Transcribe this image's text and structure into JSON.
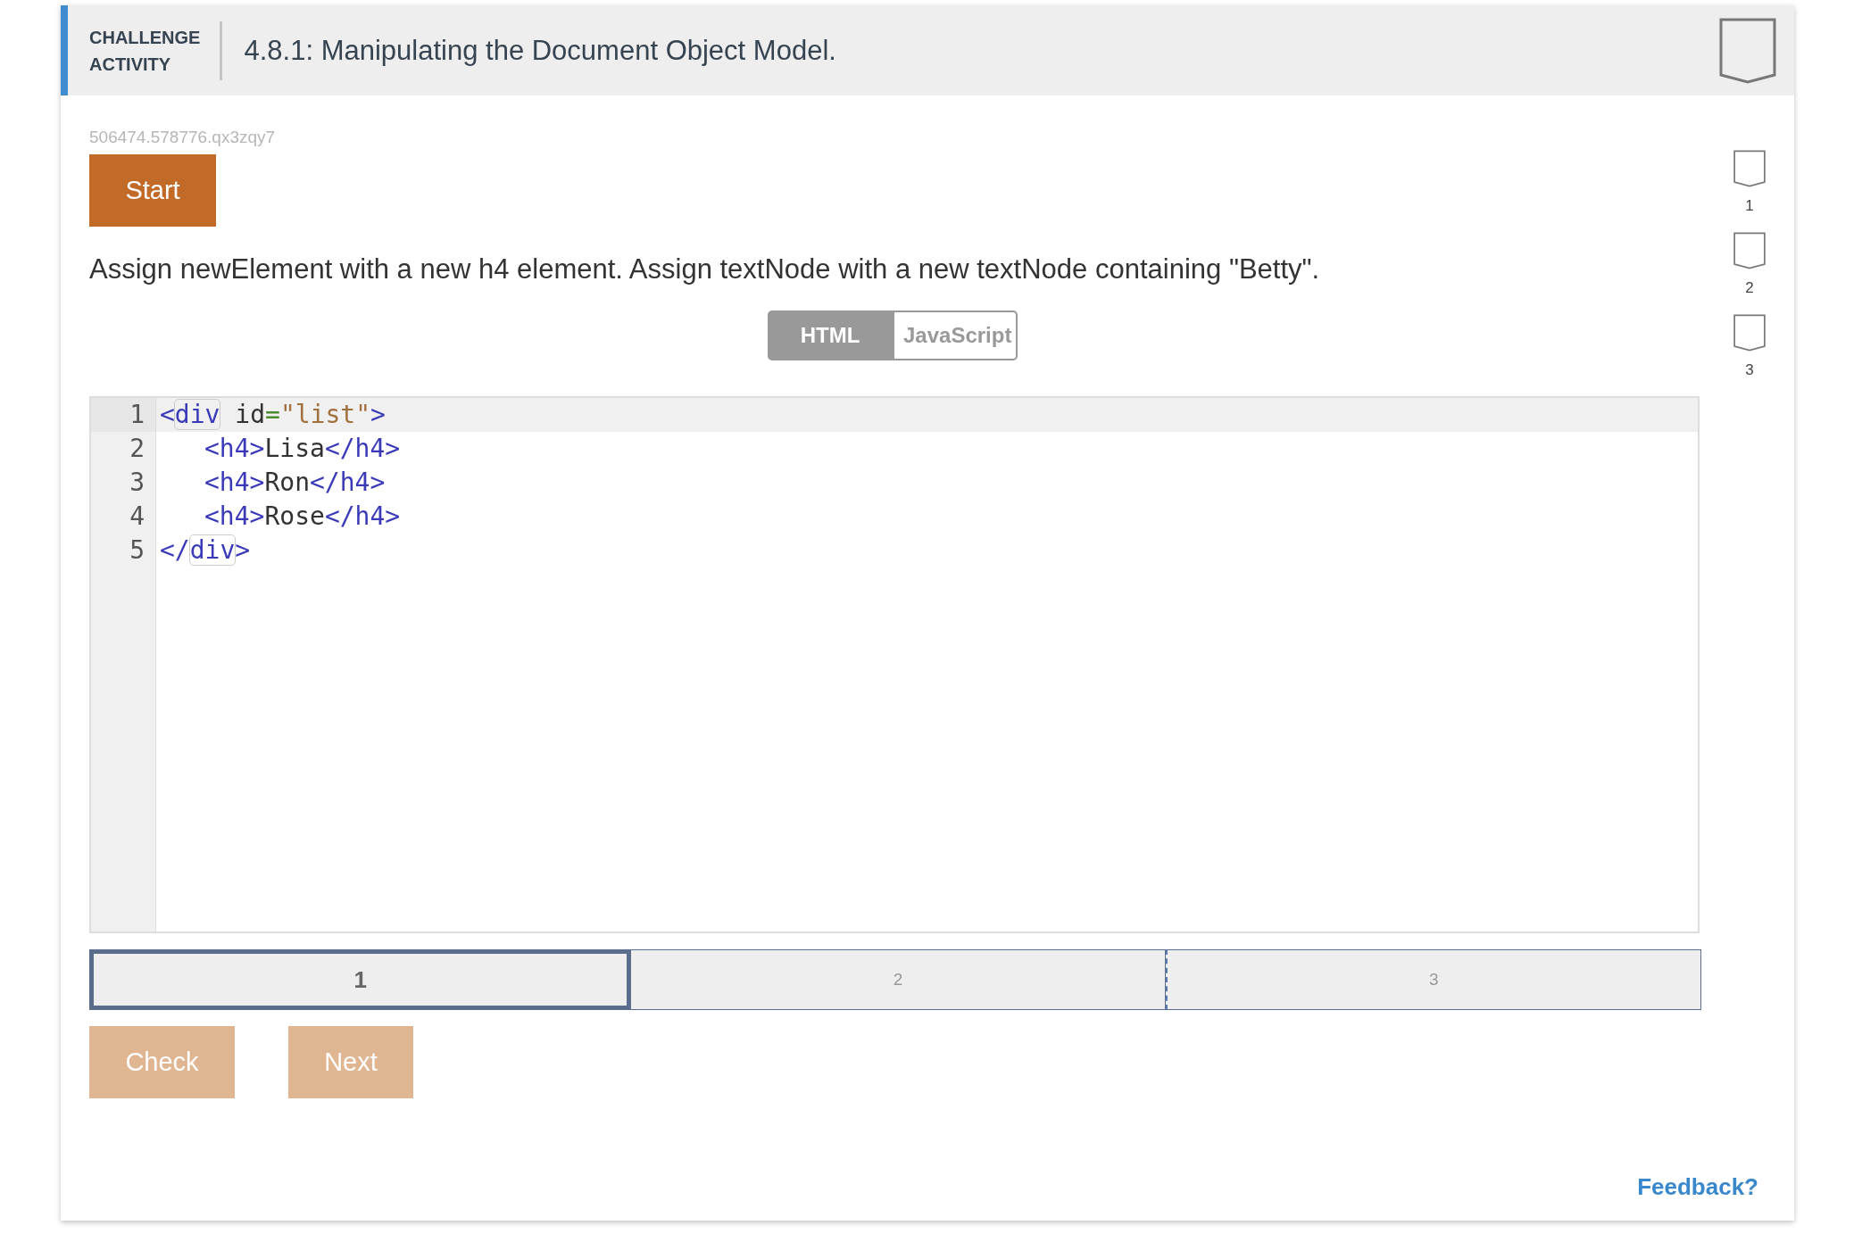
{
  "header": {
    "label_line1": "CHALLENGE",
    "label_line2": "ACTIVITY",
    "title": "4.8.1: Manipulating the Document Object Model."
  },
  "activity_id": "506474.578776.qx3zqy7",
  "start_button": {
    "label": "Start",
    "disabled": false
  },
  "instructions": "Assign newElement with a new h4 element. Assign textNode with a new textNode containing \"Betty\".",
  "tabs": [
    {
      "label": "HTML",
      "selected": true
    },
    {
      "label": "JavaScript",
      "selected": false
    }
  ],
  "editor": {
    "lines": [
      {
        "number": "1",
        "active": true,
        "tokens": [
          {
            "kind": "tag",
            "text": "<"
          },
          {
            "kind": "tag",
            "text": "div",
            "matched": true
          },
          {
            "kind": "text",
            "text": " id"
          },
          {
            "kind": "punct",
            "text": "="
          },
          {
            "kind": "string",
            "text": "\"list\""
          },
          {
            "kind": "tag",
            "text": ">"
          }
        ]
      },
      {
        "number": "2",
        "active": false,
        "indented": true,
        "tokens": [
          {
            "kind": "tag",
            "text": "<h4>"
          },
          {
            "kind": "text",
            "text": "Lisa"
          },
          {
            "kind": "tag",
            "text": "</h4>"
          }
        ]
      },
      {
        "number": "3",
        "active": false,
        "indented": true,
        "tokens": [
          {
            "kind": "tag",
            "text": "<h4>"
          },
          {
            "kind": "text",
            "text": "Ron"
          },
          {
            "kind": "tag",
            "text": "</h4>"
          }
        ]
      },
      {
        "number": "4",
        "active": false,
        "indented": true,
        "tokens": [
          {
            "kind": "tag",
            "text": "<h4>"
          },
          {
            "kind": "text",
            "text": "Rose"
          },
          {
            "kind": "tag",
            "text": "</h4>"
          }
        ]
      },
      {
        "number": "5",
        "active": false,
        "tokens": [
          {
            "kind": "tag",
            "text": "</"
          },
          {
            "kind": "tag",
            "text": "div",
            "matched": true
          },
          {
            "kind": "tag",
            "text": ">"
          }
        ]
      }
    ]
  },
  "steps": [
    {
      "label": "1",
      "selected": true
    },
    {
      "label": "2",
      "selected": false
    },
    {
      "label": "3",
      "selected": false
    }
  ],
  "buttons": [
    {
      "label": "Check",
      "disabled": true
    },
    {
      "label": "Next",
      "disabled": true
    }
  ],
  "levels": [
    {
      "label": "1"
    },
    {
      "label": "2"
    },
    {
      "label": "3"
    }
  ],
  "feedback_link": "Feedback?"
}
